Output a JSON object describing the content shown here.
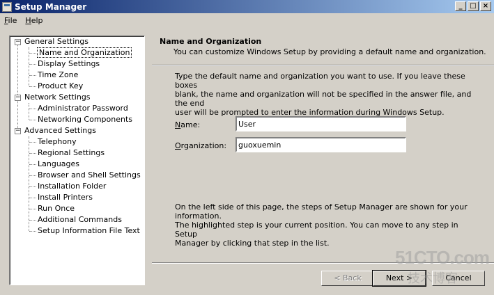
{
  "window": {
    "title": "Setup Manager",
    "min": "_",
    "max": "□",
    "close": "×"
  },
  "menu": [
    {
      "key": "F",
      "rest": "ile"
    },
    {
      "key": "H",
      "rest": "elp"
    }
  ],
  "tree": {
    "groups": [
      {
        "label": "General Settings",
        "items": [
          "Name and Organization",
          "Display Settings",
          "Time Zone",
          "Product Key"
        ]
      },
      {
        "label": "Network Settings",
        "items": [
          "Administrator Password",
          "Networking Components"
        ]
      },
      {
        "label": "Advanced Settings",
        "items": [
          "Telephony",
          "Regional Settings",
          "Languages",
          "Browser and Shell Settings",
          "Installation Folder",
          "Install Printers",
          "Run Once",
          "Additional Commands",
          "Setup Information File Text"
        ]
      }
    ],
    "expander": "−"
  },
  "page": {
    "title": "Name and Organization",
    "subtitle": "You can customize Windows Setup by providing a default name and organization.",
    "instructions": [
      "Type the default name and organization you want to use. If you leave these boxes",
      "blank, the name and organization will not be specified in the answer file, and the end",
      "user will be prompted to enter the information during Windows Setup."
    ],
    "name_label": "Name:",
    "name_value": "User",
    "org_label": "Organization:",
    "org_value": "guoxuemin",
    "help": [
      "On the left side of this page, the steps of Setup Manager are shown for your information.",
      "The highlighted step is your current position. You can move to any step in Setup",
      "Manager by clicking that step in the list."
    ]
  },
  "buttons": {
    "back": "< Back",
    "next": "Next >",
    "cancel": "Cancel"
  },
  "watermark": {
    "line1": "51CTO.com",
    "line2": "技术博客"
  }
}
